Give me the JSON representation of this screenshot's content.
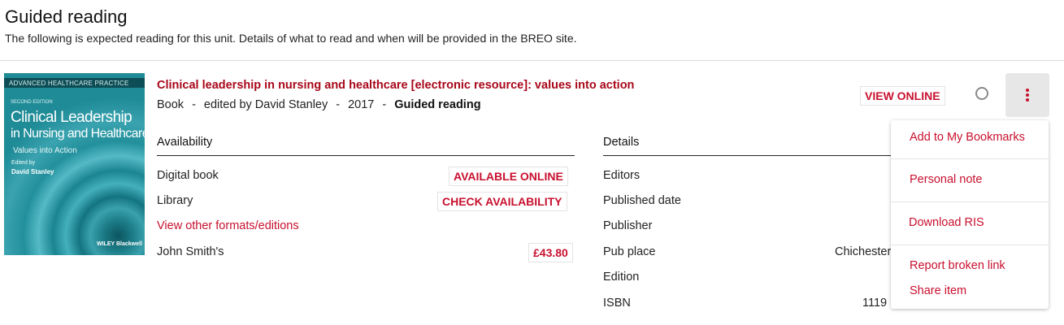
{
  "section": {
    "title": "Guided reading",
    "description": "The following is expected reading for this unit. Details of what to read and when will be provided in the BREO site."
  },
  "item": {
    "cover": {
      "series": "ADVANCED HEALTHCARE PRACTICE",
      "edition": "SECOND EDITION",
      "title_line1": "Clinical Leadership",
      "title_line2": "in Nursing and Healthcare",
      "subtitle": "Values into Action",
      "edited_by": "Edited by",
      "author": "David Stanley",
      "publisher_logo": "WILEY Blackwell"
    },
    "title": "Clinical leadership in nursing and healthcare [electronic resource]: values into action",
    "type": "Book",
    "author": "edited by David Stanley",
    "year": "2017",
    "importance": "Guided reading",
    "separator": "-",
    "view_online": "VIEW ONLINE",
    "availability": {
      "heading": "Availability",
      "rows": [
        {
          "label": "Digital book",
          "action": "AVAILABLE ONLINE"
        },
        {
          "label": "Library",
          "action": "CHECK AVAILABILITY"
        }
      ],
      "other_formats": "View other formats/editions",
      "seller": {
        "label": "John Smith's",
        "price": "£43.80"
      }
    },
    "details": {
      "heading": "Details",
      "labels": [
        "Editors",
        "Published date",
        "Publisher",
        "Pub place",
        "Edition",
        "ISBN"
      ],
      "visible_values": {
        "pub_place": "Chichester",
        "isbn": "1119"
      }
    }
  },
  "menu": {
    "items": [
      "Add to My Bookmarks",
      "Personal note",
      "Download RIS",
      "Report broken link",
      "Share item"
    ]
  },
  "colors": {
    "accent": "#c8102e",
    "title": "#a8071a",
    "cover": "#2b94a0"
  },
  "icons": {
    "read_status": "circle-outline-icon",
    "more": "kebab-menu-icon"
  }
}
